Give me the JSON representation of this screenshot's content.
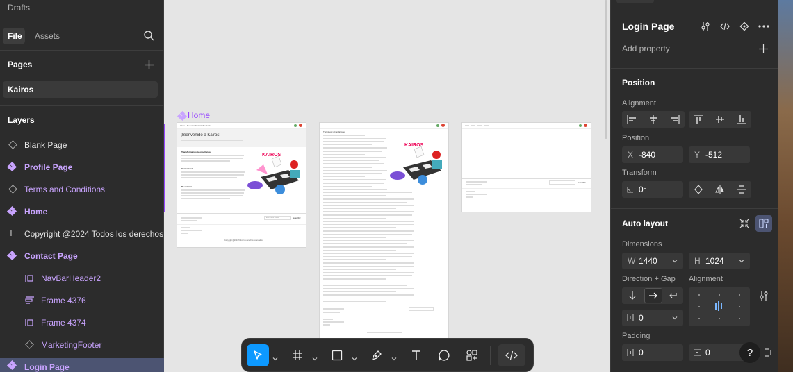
{
  "left_panel": {
    "drafts_label": "Drafts",
    "tabs": {
      "file": "File",
      "assets": "Assets"
    },
    "pages_title": "Pages",
    "pages": [
      "Kairos"
    ],
    "layers_title": "Layers",
    "layers": [
      {
        "label": "Blank Page",
        "icon": "frame-diamond-icon",
        "purple": false,
        "indent": false
      },
      {
        "label": "Profile Page",
        "icon": "component-icon",
        "purple": true,
        "indent": false
      },
      {
        "label": "Terms and Conditions",
        "icon": "frame-diamond-icon",
        "purple": true,
        "indent": false
      },
      {
        "label": "Home",
        "icon": "component-icon",
        "purple": true,
        "indent": false
      },
      {
        "label": "Copyright @2024 Todos los derechos",
        "icon": "text-icon",
        "purple": false,
        "indent": false
      },
      {
        "label": "Contact Page",
        "icon": "component-icon",
        "purple": true,
        "indent": false
      },
      {
        "label": "NavBarHeader2",
        "icon": "autolayout-icon",
        "purple": true,
        "indent": true
      },
      {
        "label": "Frame 4376",
        "icon": "autolayout-vertical-icon",
        "purple": true,
        "indent": true
      },
      {
        "label": "Frame 4374",
        "icon": "autolayout-icon",
        "purple": true,
        "indent": true
      },
      {
        "label": "MarketingFooter",
        "icon": "frame-diamond-icon",
        "purple": true,
        "indent": true
      },
      {
        "label": "Login Page",
        "icon": "component-icon",
        "purple": true,
        "indent": false,
        "selected": true
      }
    ]
  },
  "canvas": {
    "home_label": "Home",
    "home_frame": {
      "nav": [
        "Inicio",
        "Nosotros",
        "Servicios",
        "Contacto"
      ],
      "heading": "¡Bienvenido a Kairos!",
      "section1": "Transformando tu enseñanza",
      "section2": "Comunidad",
      "section3": "Tu opinión",
      "footer_input": "Escribe tu correo",
      "footer_button": "Suscribir",
      "copyright": "Copyright @2024 Todos los derechos reservados"
    },
    "terms_frame": {
      "title": "Términos y Condiciones"
    },
    "login_frame": {
      "footer_button": "Suscribir"
    },
    "logo_text": "KAIROS"
  },
  "toolbar": {
    "tools": [
      "move-tool",
      "frame-tool",
      "shape-tool",
      "pen-tool",
      "text-tool",
      "comment-tool",
      "actions-tool",
      "dev-mode-toggle"
    ]
  },
  "right_panel": {
    "title": "Login Page",
    "add_property": "Add property",
    "position_title": "Position",
    "alignment_label": "Alignment",
    "position_label": "Position",
    "x_label": "X",
    "x_value": "-840",
    "y_label": "Y",
    "y_value": "-512",
    "transform_label": "Transform",
    "rotation_value": "0°",
    "auto_layout_title": "Auto layout",
    "dimensions_label": "Dimensions",
    "w_label": "W",
    "w_value": "1440",
    "h_label": "H",
    "h_value": "1024",
    "direction_gap_label": "Direction + Gap",
    "alignment2_label": "Alignment",
    "gap_value": "0",
    "padding_label": "Padding",
    "padding_h_value": "0",
    "padding_v_value": "0",
    "help": "?"
  },
  "colors": {
    "panel_bg": "#2c2c2c",
    "canvas_bg": "#e5e5e5",
    "accent_purple": "#c9a4ff",
    "selection_blue": "#0d99ff",
    "selected_layer_bg": "#4c5472"
  }
}
